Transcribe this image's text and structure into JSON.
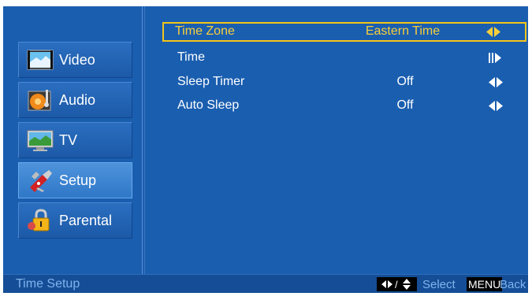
{
  "sidebar": {
    "items": [
      {
        "label": "Video",
        "icon": "video-icon",
        "active": false
      },
      {
        "label": "Audio",
        "icon": "audio-icon",
        "active": false
      },
      {
        "label": "TV",
        "icon": "tv-icon",
        "active": false
      },
      {
        "label": "Setup",
        "icon": "setup-icon",
        "active": true
      },
      {
        "label": "Parental",
        "icon": "parental-lock-icon",
        "active": false
      }
    ]
  },
  "settings": {
    "rows": [
      {
        "label": "Time Zone",
        "value": "Eastern Time",
        "control": "left-right-arrows",
        "selected": true
      },
      {
        "label": "Time",
        "value": "",
        "control": "enter-arrow",
        "selected": false
      },
      {
        "label": "Sleep Timer",
        "value": "Off",
        "control": "left-right-arrows",
        "selected": false
      },
      {
        "label": "Auto Sleep",
        "value": "Off",
        "control": "left-right-arrows",
        "selected": false
      }
    ]
  },
  "footer": {
    "title": "Time Setup",
    "select_hint": "Select",
    "menu_key": "MENU",
    "back_hint": "Back"
  },
  "colors": {
    "background": "#1a5eb0",
    "highlight": "#f5c518",
    "footer_text": "#7fb3ee"
  }
}
